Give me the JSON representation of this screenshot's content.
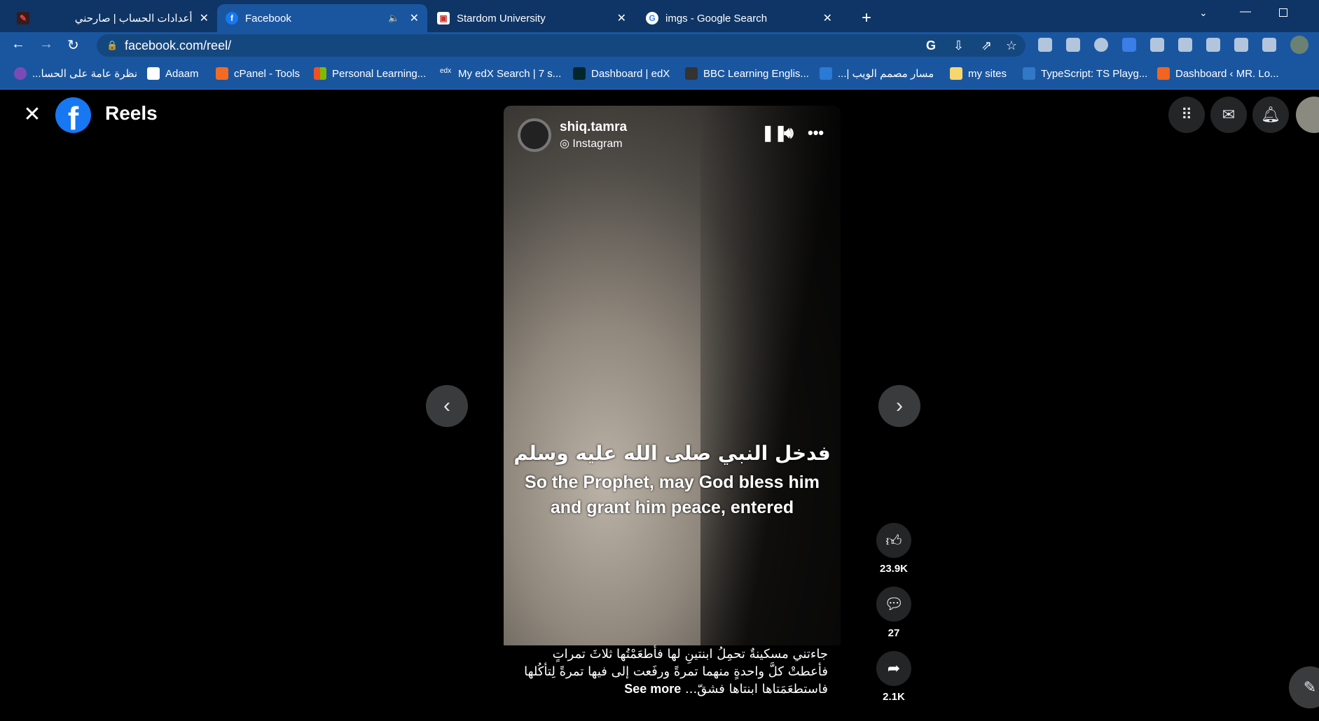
{
  "browser": {
    "tabs": [
      {
        "title": "أعدادات الحساب | صارحني",
        "close": "✕"
      },
      {
        "title": "Facebook",
        "close": "✕",
        "audio": "🔈"
      },
      {
        "title": "Stardom University",
        "close": "✕"
      },
      {
        "title": "imgs - Google Search",
        "close": "✕"
      }
    ],
    "new_tab": "+",
    "url": "facebook.com/reel/",
    "bookmarks": [
      "نظرة عامة على الحسا...",
      "Adaam",
      "cPanel - Tools",
      "Personal Learning...",
      "My edX Search | 7 s...",
      "Dashboard | edX",
      "BBC Learning Englis...",
      "مسار مصمم الويب |...",
      "my sites",
      "TypeScript: TS Playg...",
      "Dashboard ‹ MR. Lo..."
    ],
    "colors": {
      "tabbar": "#0e3566",
      "toolbar": "#1a56a0",
      "fb_blue": "#1877f2"
    }
  },
  "page": {
    "title": "Reels",
    "reel": {
      "author": "shiq.tamra",
      "source": "Instagram",
      "subtitle_ar": "فدخل النبي صلى الله عليه وسلم",
      "subtitle_en": "So the Prophet, may God bless him and grant him peace, entered",
      "caption_lines": [
        "جاءتني مسكينةٌ تحمِلُ ابنتينِ لها فأطعَمْتُها ثلاثَ تمراتٍ",
        "فأعطتْ كلَّ واحدةٍ منهما تمرةً ورفَعت إلى فيها تمرةً لِتأكُلها",
        "فاستطعَمَتاها ابنتاها فشقّ..."
      ],
      "see_more": "See more",
      "likes": "23.9K",
      "comments": "27",
      "shares": "2.1K"
    }
  }
}
